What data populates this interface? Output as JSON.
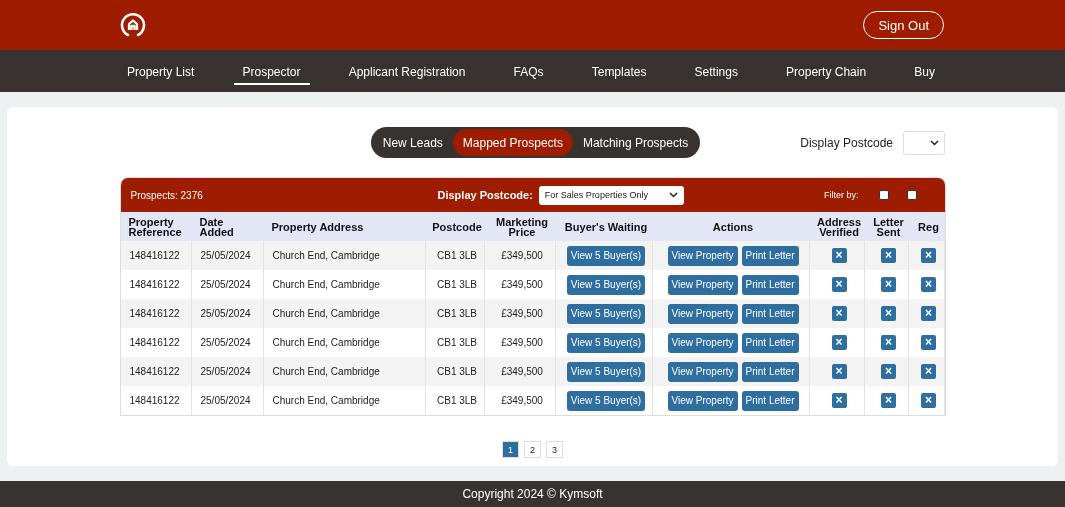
{
  "header": {
    "sign_out": "Sign Out"
  },
  "nav": [
    {
      "label": "Property List",
      "selected": false
    },
    {
      "label": "Prospector",
      "selected": true
    },
    {
      "label": "Applicant Registration",
      "selected": false
    },
    {
      "label": "FAQs",
      "selected": false
    },
    {
      "label": "Templates",
      "selected": false
    },
    {
      "label": "Settings",
      "selected": false
    },
    {
      "label": "Property Chain",
      "selected": false
    },
    {
      "label": "Buy",
      "selected": false
    }
  ],
  "segments": [
    {
      "label": "New Leads",
      "selected": false
    },
    {
      "label": "Mapped Prospects",
      "selected": true
    },
    {
      "label": "Matching Prospects",
      "selected": false
    }
  ],
  "display_postcode": {
    "label": "Display Postcode"
  },
  "table_bar": {
    "count": "Prospects: 2376",
    "filter_label": "Display Postcode:",
    "filter_value": "For Sales Properties Only",
    "filter_by": "Filter by:",
    "filters": [
      {
        "checked": false
      },
      {
        "checked": false
      }
    ]
  },
  "columns": [
    "Property Reference",
    "Date Added",
    "Property Address",
    "Postcode",
    "Marketing Price",
    "Buyer's Waiting",
    "Actions",
    "Address Verified",
    "Letter Sent",
    "Reg"
  ],
  "rows": [
    {
      "ref": "148416122",
      "date": "25/05/2024",
      "address": "Church End, Cambridge",
      "postcode": "CB1 3LB",
      "price": "£349,500",
      "buyers": "View 5 Buyer(s)",
      "actions": [
        "View Property",
        "Print Letter"
      ],
      "flags": [
        "×",
        "×",
        "×"
      ]
    },
    {
      "ref": "148416122",
      "date": "25/05/2024",
      "address": "Church End, Cambridge",
      "postcode": "CB1 3LB",
      "price": "£349,500",
      "buyers": "View 5 Buyer(s)",
      "actions": [
        "View Property",
        "Print Letter"
      ],
      "flags": [
        "×",
        "×",
        "×"
      ]
    },
    {
      "ref": "148416122",
      "date": "25/05/2024",
      "address": "Church End, Cambridge",
      "postcode": "CB1 3LB",
      "price": "£349,500",
      "buyers": "View 5 Buyer(s)",
      "actions": [
        "View Property",
        "Print Letter"
      ],
      "flags": [
        "×",
        "×",
        "×"
      ]
    },
    {
      "ref": "148416122",
      "date": "25/05/2024",
      "address": "Church End, Cambridge",
      "postcode": "CB1 3LB",
      "price": "£349,500",
      "buyers": "View 5 Buyer(s)",
      "actions": [
        "View Property",
        "Print Letter"
      ],
      "flags": [
        "×",
        "×",
        "×"
      ]
    },
    {
      "ref": "148416122",
      "date": "25/05/2024",
      "address": "Church End, Cambridge",
      "postcode": "CB1 3LB",
      "price": "£349,500",
      "buyers": "View 5 Buyer(s)",
      "actions": [
        "View Property",
        "Print Letter"
      ],
      "flags": [
        "×",
        "×",
        "×"
      ]
    },
    {
      "ref": "148416122",
      "date": "25/05/2024",
      "address": "Church End, Cambridge",
      "postcode": "CB1 3LB",
      "price": "£349,500",
      "buyers": "View 5 Buyer(s)",
      "actions": [
        "View Property",
        "Print Letter"
      ],
      "flags": [
        "×",
        "×",
        "×"
      ]
    }
  ],
  "pagination": [
    {
      "label": "1",
      "selected": true
    },
    {
      "label": "2",
      "selected": false
    },
    {
      "label": "3",
      "selected": false
    }
  ],
  "footer": "Copyright 2024 © Kymsoft"
}
